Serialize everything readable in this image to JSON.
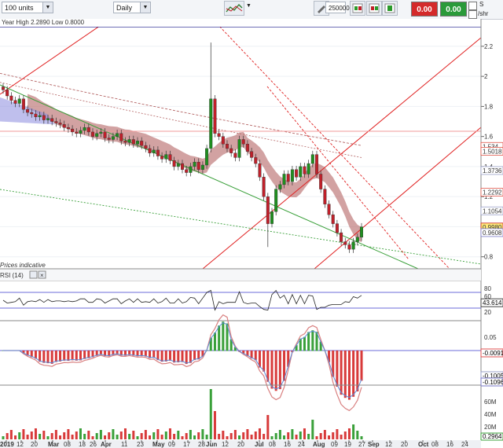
{
  "toolbar": {
    "units": "100 units",
    "timeframe": "Daily",
    "quantity": "250000",
    "sell_price": "0.00",
    "buy_price": "0.00",
    "checkbox_s": "S",
    "checkbox_per_share": "/shr"
  },
  "info": {
    "year_high_low": "Year High 2.2890 Low 0.8000",
    "indicative": "Prices indicative",
    "rsi_label": "RSI (14)"
  },
  "colors": {
    "up": "#1f8f1f",
    "down": "#c0202a",
    "trend_red": "#e02020",
    "support_green": "#3aa03a",
    "navy_line": "#1a1a8c",
    "ribbon": "#b46464",
    "ribbon_blue": "#8a8adf"
  },
  "chart_data": {
    "type": "candlestick",
    "price_axis": {
      "ticks": [
        2.2,
        2,
        1.8,
        1.6,
        1.4,
        1.2,
        1,
        0.8
      ],
      "ylim": [
        0.72,
        2.33
      ]
    },
    "price_labels": [
      "1.534",
      "1.5018",
      "1.3736",
      "1.2292",
      "1.1054",
      "0.9980",
      "0.9608"
    ],
    "x_labels": [
      "2019",
      "12",
      "20",
      "Mar",
      "08",
      "18",
      "26",
      "Apr",
      "11",
      "23",
      "May",
      "09",
      "17",
      "28",
      "Jun",
      "12",
      "20",
      "Jul",
      "08",
      "16",
      "24",
      "Aug",
      "09",
      "19",
      "27",
      "Sep",
      "12",
      "20",
      "Oct",
      "08",
      "16",
      "24"
    ],
    "closes": [
      1.91,
      1.87,
      1.84,
      1.82,
      1.85,
      1.78,
      1.76,
      1.75,
      1.73,
      1.74,
      1.71,
      1.72,
      1.7,
      1.69,
      1.68,
      1.66,
      1.65,
      1.63,
      1.62,
      1.64,
      1.66,
      1.63,
      1.6,
      1.62,
      1.63,
      1.59,
      1.58,
      1.6,
      1.62,
      1.57,
      1.56,
      1.58,
      1.55,
      1.57,
      1.54,
      1.52,
      1.49,
      1.51,
      1.47,
      1.45,
      1.48,
      1.44,
      1.4,
      1.42,
      1.38,
      1.36,
      1.4,
      1.43,
      1.38,
      1.41,
      1.52,
      1.85,
      1.62,
      1.6,
      1.55,
      1.52,
      1.49,
      1.46,
      1.58,
      1.55,
      1.5,
      1.46,
      1.42,
      1.33,
      1.2,
      1.02,
      1.1,
      1.25,
      1.28,
      1.35,
      1.3,
      1.38,
      1.33,
      1.4,
      1.35,
      1.42,
      1.48,
      1.35,
      1.25,
      1.15,
      1.08,
      1.02,
      0.96,
      0.9,
      0.88,
      0.85,
      0.9,
      0.93,
      0.999
    ],
    "rsi": {
      "value": "43.614",
      "levels": [
        80,
        60,
        40,
        20
      ],
      "last": 43.6
    },
    "macd": {
      "ticks": [
        "0.05"
      ],
      "labels": [
        "-0.0091",
        "-0.1005",
        "-0.1096"
      ]
    },
    "volume": {
      "ticks": [
        "60M",
        "40M",
        "20M"
      ],
      "label": "0.2964"
    }
  }
}
